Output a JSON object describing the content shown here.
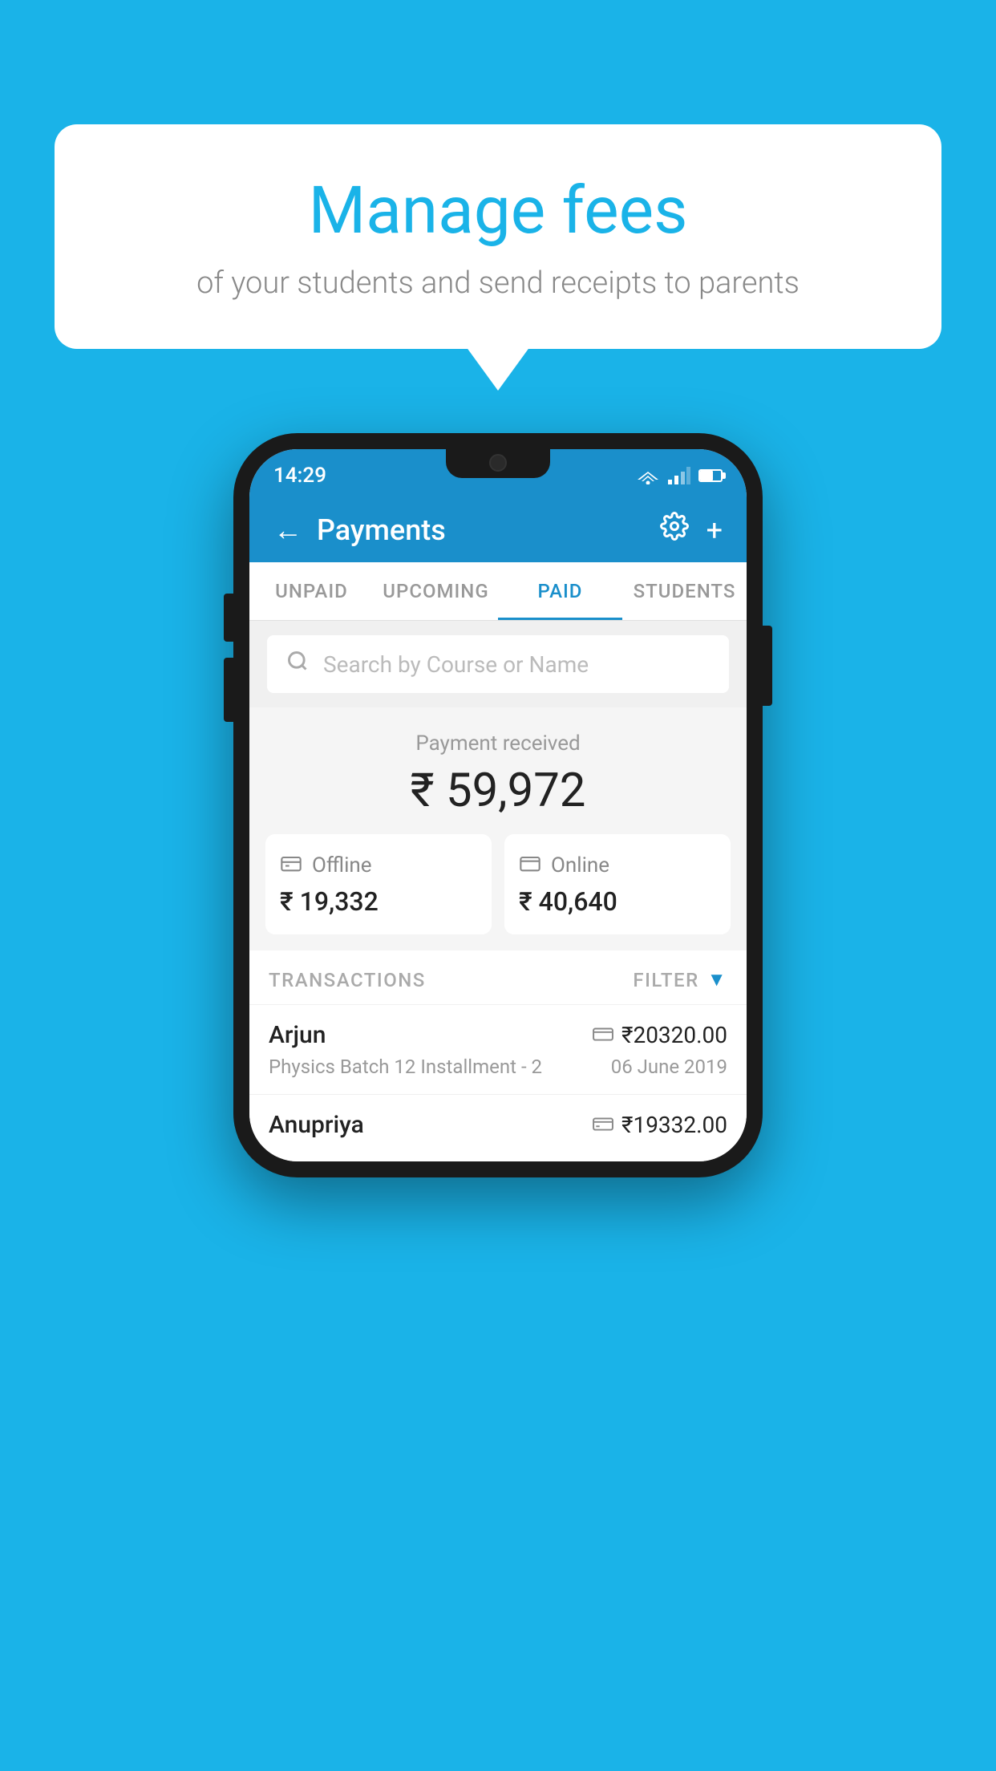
{
  "background_color": "#1ab3e8",
  "bubble": {
    "title": "Manage fees",
    "subtitle": "of your students and send receipts to parents"
  },
  "status_bar": {
    "time": "14:29"
  },
  "header": {
    "title": "Payments",
    "back_label": "←",
    "settings_icon": "⚙",
    "add_icon": "+"
  },
  "tabs": [
    {
      "label": "UNPAID",
      "active": false
    },
    {
      "label": "UPCOMING",
      "active": false
    },
    {
      "label": "PAID",
      "active": true
    },
    {
      "label": "STUDENTS",
      "active": false
    }
  ],
  "search": {
    "placeholder": "Search by Course or Name"
  },
  "payment_summary": {
    "label": "Payment received",
    "amount": "₹ 59,972",
    "offline_label": "Offline",
    "offline_amount": "₹ 19,332",
    "online_label": "Online",
    "online_amount": "₹ 40,640"
  },
  "transactions": {
    "header_label": "TRANSACTIONS",
    "filter_label": "FILTER",
    "items": [
      {
        "name": "Arjun",
        "detail": "Physics Batch 12 Installment - 2",
        "amount": "₹20320.00",
        "date": "06 June 2019",
        "payment_type": "online"
      },
      {
        "name": "Anupriya",
        "detail": "",
        "amount": "₹19332.00",
        "date": "",
        "payment_type": "offline"
      }
    ]
  }
}
